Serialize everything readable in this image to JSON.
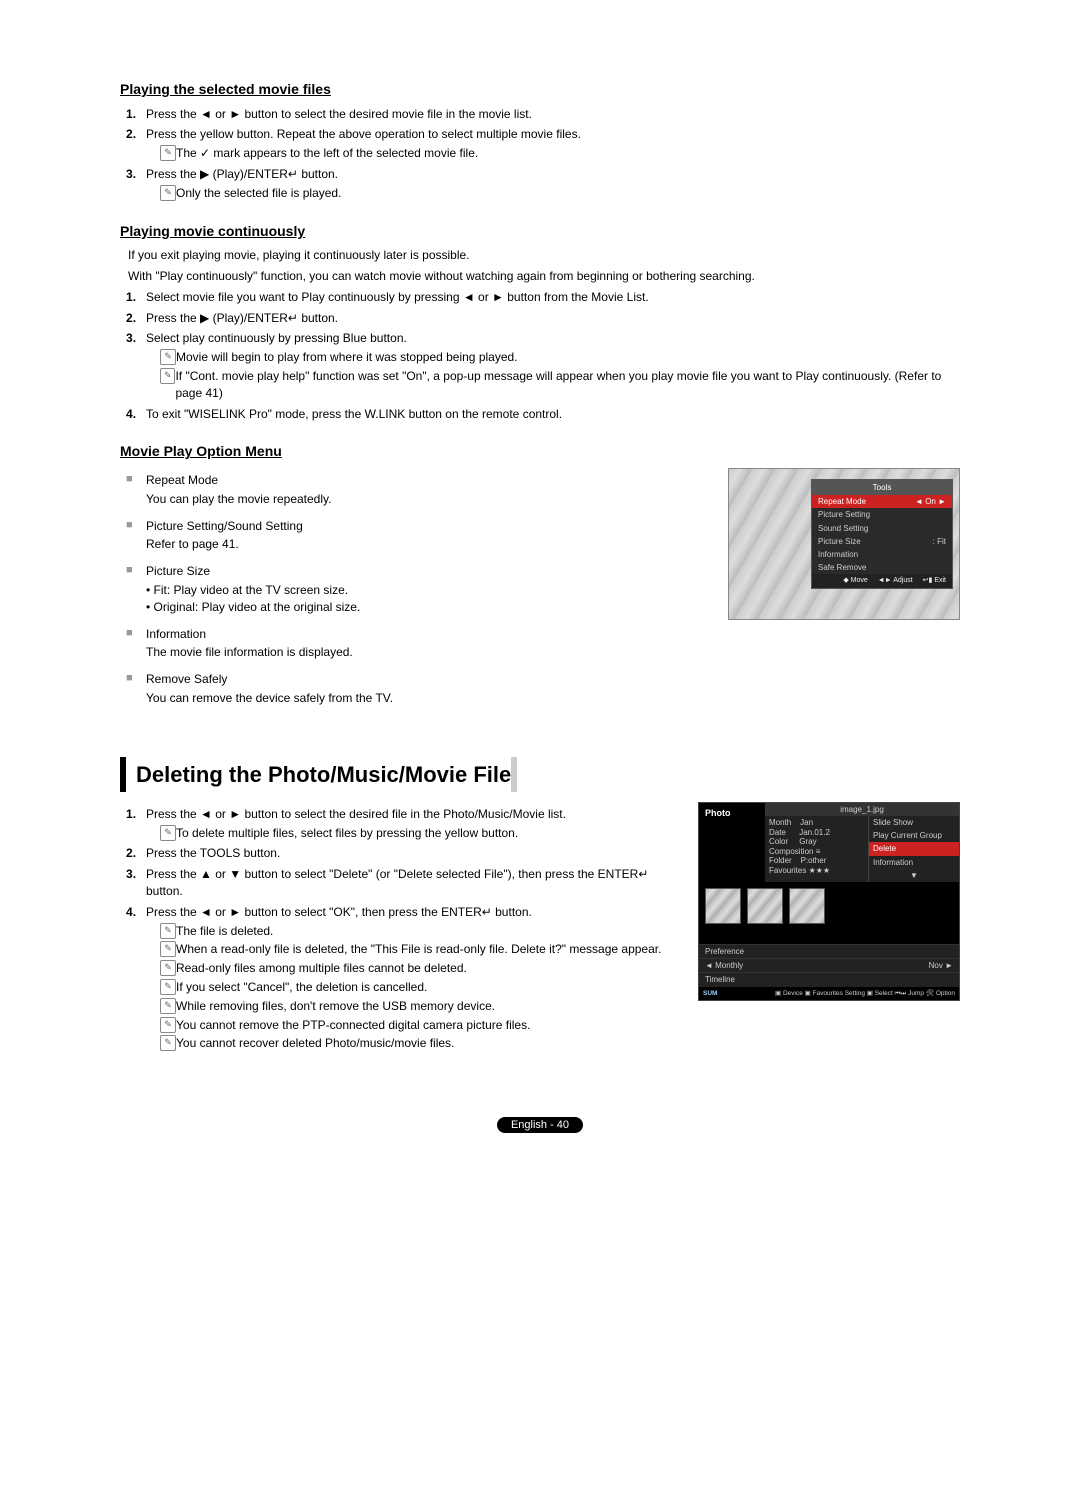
{
  "section1": {
    "title": "Playing the selected movie files",
    "items": [
      "Press the ◄ or ► button to select the desired movie file in the movie list.",
      "Press the yellow button. Repeat the above operation to select multiple movie files.",
      "Press the ▶ (Play)/ENTER↵ button."
    ],
    "sub2": "The ✓ mark appears to the left of the selected movie file.",
    "sub3": "Only the selected file is played."
  },
  "section2": {
    "title": "Playing movie continuously",
    "intro1": "If you exit playing movie, playing it continuously later is possible.",
    "intro2": "With \"Play continuously\" function, you can watch movie without watching again from beginning or bothering searching.",
    "items": [
      "Select movie file you want to Play continuously by pressing ◄ or ► button from the Movie List.",
      "Press the ▶ (Play)/ENTER↵ button.",
      "Select play continuously by pressing Blue button.",
      "To exit \"WISELINK Pro\" mode, press the W.LINK button on the remote control."
    ],
    "sub3a": "Movie will begin to play from where it was stopped being played.",
    "sub3b": "If \"Cont. movie play help\" function was set \"On\", a pop-up message will appear when you play movie file you want to Play continuously. (Refer to page 41)"
  },
  "section3": {
    "title": "Movie Play Option Menu",
    "options": [
      {
        "name": "Repeat Mode",
        "desc": "You can play the movie repeatedly."
      },
      {
        "name": "Picture Setting/Sound Setting",
        "desc": "Refer to page 41."
      },
      {
        "name": "Picture Size",
        "subs": [
          "Fit: Play video at the TV screen size.",
          "Original: Play video at the original size."
        ]
      },
      {
        "name": "Information",
        "desc": "The movie file information is displayed."
      },
      {
        "name": "Remove Safely",
        "desc": "You can remove the device safely from the TV."
      }
    ]
  },
  "tools_mock": {
    "title": "Tools",
    "rows": [
      {
        "label": "Repeat Mode",
        "value": "◄   On   ►",
        "sel": true
      },
      {
        "label": "Picture Setting"
      },
      {
        "label": "Sound Setting"
      },
      {
        "label": "Picture Size",
        "value": ":      Fit"
      },
      {
        "label": "Information"
      },
      {
        "label": "Safe Remove"
      }
    ],
    "bottom": [
      "◆ Move",
      "◄► Adjust",
      "↩▮ Exit"
    ]
  },
  "section4": {
    "title": "Deleting the Photo/Music/Movie File",
    "items": [
      "Press the ◄ or ► button to select the desired file in the Photo/Music/Movie list.",
      "Press the TOOLS button.",
      "Press the ▲ or ▼ button to select \"Delete\" (or \"Delete selected File\"), then press the ENTER↵ button.",
      "Press the ◄ or ► button to select \"OK\", then press the ENTER↵ button."
    ],
    "sub1": "To delete multiple files, select files by pressing the yellow button.",
    "sub4": [
      "The file is deleted.",
      "When a read-only file is deleted, the \"This File is read-only file. Delete it?\" message appear.",
      "Read-only files among multiple files cannot be deleted.",
      "If you select \"Cancel\", the deletion is cancelled.",
      "While removing files, don't remove the USB memory device.",
      "You cannot remove the PTP-connected digital camera picture files.",
      "You cannot recover deleted Photo/music/movie files."
    ]
  },
  "photo_mock": {
    "header": "Photo",
    "filename": "image_1.jpg",
    "info": {
      "Month": "Jan",
      "Date": "Jan.01.2",
      "Color": "Gray",
      "Composition": "≡",
      "Folder": "P:other",
      "Favourites": "★★★"
    },
    "menu": [
      "Slide Show",
      "Play Current Group",
      "Delete",
      "Information"
    ],
    "menu_sel": "Delete",
    "tabs": {
      "preference": "Preference",
      "monthly": "Monthly",
      "monthly_right": "Nov",
      "timeline": "Timeline"
    },
    "sum": "SUM",
    "bottom": "▣ Device ▣ Favourites Setting ▣ Select ⏮⏭ Jump 🛠 Option"
  },
  "footer": "English - 40"
}
